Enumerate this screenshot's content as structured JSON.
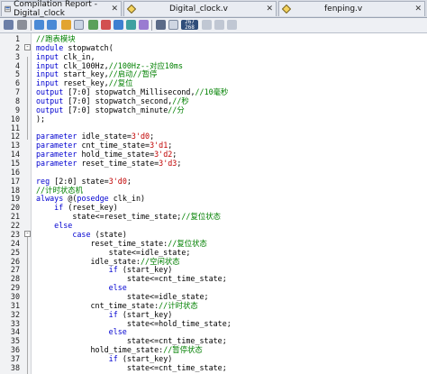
{
  "tabs": [
    {
      "label": "Compilation Report - Digital_clock",
      "icon": "report-icon"
    },
    {
      "label": "Digital_clock.v",
      "icon": "verilog-file-icon"
    },
    {
      "label": "fenping.v",
      "icon": "verilog-file-icon"
    }
  ],
  "toolbar": [
    "open-icon",
    "copy-icon",
    "indent-icon",
    "outdent-icon",
    "uncomment-icon",
    "comment-icon",
    "bookmark-icon",
    "bookmark-next-icon",
    "bookmark-prev-icon",
    "bookmark-clear-icon",
    "insert-template-icon",
    "find-icon",
    "line-number-icon",
    "zoom-icon",
    "tab-icon",
    "wrap-icon"
  ],
  "toolbar_badge": "267\n268",
  "lines": [
    {
      "n": "1",
      "fold": "",
      "tokens": [
        [
          "cm",
          "//跑表模块"
        ]
      ]
    },
    {
      "n": "2",
      "fold": "-",
      "tokens": [
        [
          "kw",
          "module"
        ],
        [
          "",
          "stopwatch("
        ]
      ]
    },
    {
      "n": "3",
      "fold": "",
      "tokens": [
        [
          "kw",
          "input"
        ],
        [
          "",
          "clk_in,"
        ]
      ]
    },
    {
      "n": "4",
      "fold": "",
      "tokens": [
        [
          "kw",
          "input"
        ],
        [
          "",
          "clk_100Hz,"
        ],
        [
          "cm",
          "//100Hz--对应10ms"
        ]
      ]
    },
    {
      "n": "5",
      "fold": "",
      "tokens": [
        [
          "kw",
          "input"
        ],
        [
          "",
          "start_key,"
        ],
        [
          "cm",
          "//启动//暂停"
        ]
      ]
    },
    {
      "n": "6",
      "fold": "",
      "tokens": [
        [
          "kw",
          "input"
        ],
        [
          "",
          "reset_key,"
        ],
        [
          "cm",
          "//复位"
        ]
      ]
    },
    {
      "n": "7",
      "fold": "",
      "tokens": [
        [
          "kw",
          "output"
        ],
        [
          "",
          "[7:0] stopwatch_Millisecond,"
        ],
        [
          "cm",
          "//10毫秒"
        ]
      ]
    },
    {
      "n": "8",
      "fold": "",
      "tokens": [
        [
          "kw",
          "output"
        ],
        [
          "",
          "[7:0] stopwatch_second,"
        ],
        [
          "cm",
          "//秒"
        ]
      ]
    },
    {
      "n": "9",
      "fold": "",
      "tokens": [
        [
          "kw",
          "output"
        ],
        [
          "",
          "[7:0] stopwatch_minute"
        ],
        [
          "cm",
          "//分"
        ]
      ]
    },
    {
      "n": "10",
      "fold": "",
      "tokens": [
        [
          "",
          ");"
        ]
      ]
    },
    {
      "n": "11",
      "fold": "",
      "tokens": []
    },
    {
      "n": "12",
      "fold": "",
      "tokens": [
        [
          "kw",
          "parameter"
        ],
        [
          "",
          "idle_state="
        ],
        [
          "nm",
          "3'd0"
        ],
        [
          "",
          ";"
        ]
      ]
    },
    {
      "n": "13",
      "fold": "",
      "tokens": [
        [
          "kw",
          "parameter"
        ],
        [
          "",
          "cnt_time_state="
        ],
        [
          "nm",
          "3'd1"
        ],
        [
          "",
          ";"
        ]
      ]
    },
    {
      "n": "14",
      "fold": "",
      "tokens": [
        [
          "kw",
          "parameter"
        ],
        [
          "",
          "hold_time_state="
        ],
        [
          "nm",
          "3'd2"
        ],
        [
          "",
          ";"
        ]
      ]
    },
    {
      "n": "15",
      "fold": "",
      "tokens": [
        [
          "kw",
          "parameter"
        ],
        [
          "",
          "reset_time_state="
        ],
        [
          "nm",
          "3'd3"
        ],
        [
          "",
          ";"
        ]
      ]
    },
    {
      "n": "16",
      "fold": "",
      "tokens": []
    },
    {
      "n": "17",
      "fold": "",
      "tokens": [
        [
          "kw",
          "reg"
        ],
        [
          "",
          "[2:0] state="
        ],
        [
          "nm",
          "3'd0"
        ],
        [
          "",
          ";"
        ]
      ]
    },
    {
      "n": "18",
      "fold": "",
      "tokens": [
        [
          "cm",
          "//计时状态机"
        ]
      ]
    },
    {
      "n": "19",
      "fold": "",
      "tokens": [
        [
          "kw",
          "always"
        ],
        [
          "",
          "@("
        ],
        [
          "kw",
          "posedge"
        ],
        [
          "",
          "clk_in)"
        ]
      ]
    },
    {
      "n": "20",
      "fold": "",
      "tokens": [
        [
          "kw",
          "    if"
        ],
        [
          "",
          "(reset_key)"
        ]
      ]
    },
    {
      "n": "21",
      "fold": "",
      "tokens": [
        [
          "",
          "        state<=reset_time_state;"
        ],
        [
          "cm",
          "//复位状态"
        ]
      ]
    },
    {
      "n": "22",
      "fold": "",
      "tokens": [
        [
          "kw",
          "    else"
        ]
      ]
    },
    {
      "n": "23",
      "fold": "-",
      "tokens": [
        [
          "kw",
          "        case"
        ],
        [
          "",
          "(state)"
        ]
      ]
    },
    {
      "n": "24",
      "fold": "",
      "tokens": [
        [
          "",
          "            reset_time_state:"
        ],
        [
          "cm",
          "//复位状态"
        ]
      ]
    },
    {
      "n": "25",
      "fold": "",
      "tokens": [
        [
          "",
          "                state<=idle_state;"
        ]
      ]
    },
    {
      "n": "26",
      "fold": "",
      "tokens": [
        [
          "",
          "            idle_state:"
        ],
        [
          "cm",
          "//空闲状态"
        ]
      ]
    },
    {
      "n": "27",
      "fold": "",
      "tokens": [
        [
          "kw",
          "                if"
        ],
        [
          "",
          "(start_key)"
        ]
      ]
    },
    {
      "n": "28",
      "fold": "",
      "tokens": [
        [
          "",
          "                    state<=cnt_time_state;"
        ]
      ]
    },
    {
      "n": "29",
      "fold": "",
      "tokens": [
        [
          "kw",
          "                else"
        ]
      ]
    },
    {
      "n": "30",
      "fold": "",
      "tokens": [
        [
          "",
          "                    state<=idle_state;"
        ]
      ]
    },
    {
      "n": "31",
      "fold": "",
      "tokens": [
        [
          "",
          "            cnt_time_state:"
        ],
        [
          "cm",
          "//计时状态"
        ]
      ]
    },
    {
      "n": "32",
      "fold": "",
      "tokens": [
        [
          "kw",
          "                if"
        ],
        [
          "",
          "(start_key)"
        ]
      ]
    },
    {
      "n": "33",
      "fold": "",
      "tokens": [
        [
          "",
          "                    state<=hold_time_state;"
        ]
      ]
    },
    {
      "n": "34",
      "fold": "",
      "tokens": [
        [
          "kw",
          "                else"
        ]
      ]
    },
    {
      "n": "35",
      "fold": "",
      "tokens": [
        [
          "",
          "                    state<=cnt_time_state;"
        ]
      ]
    },
    {
      "n": "36",
      "fold": "",
      "tokens": [
        [
          "",
          "            hold_time_state:"
        ],
        [
          "cm",
          "//暂停状态"
        ]
      ]
    },
    {
      "n": "37",
      "fold": "",
      "tokens": [
        [
          "kw",
          "                if"
        ],
        [
          "",
          "(start_key)"
        ]
      ]
    },
    {
      "n": "38",
      "fold": "",
      "tokens": [
        [
          "",
          "                    state<=cnt_time_state;"
        ]
      ]
    }
  ]
}
